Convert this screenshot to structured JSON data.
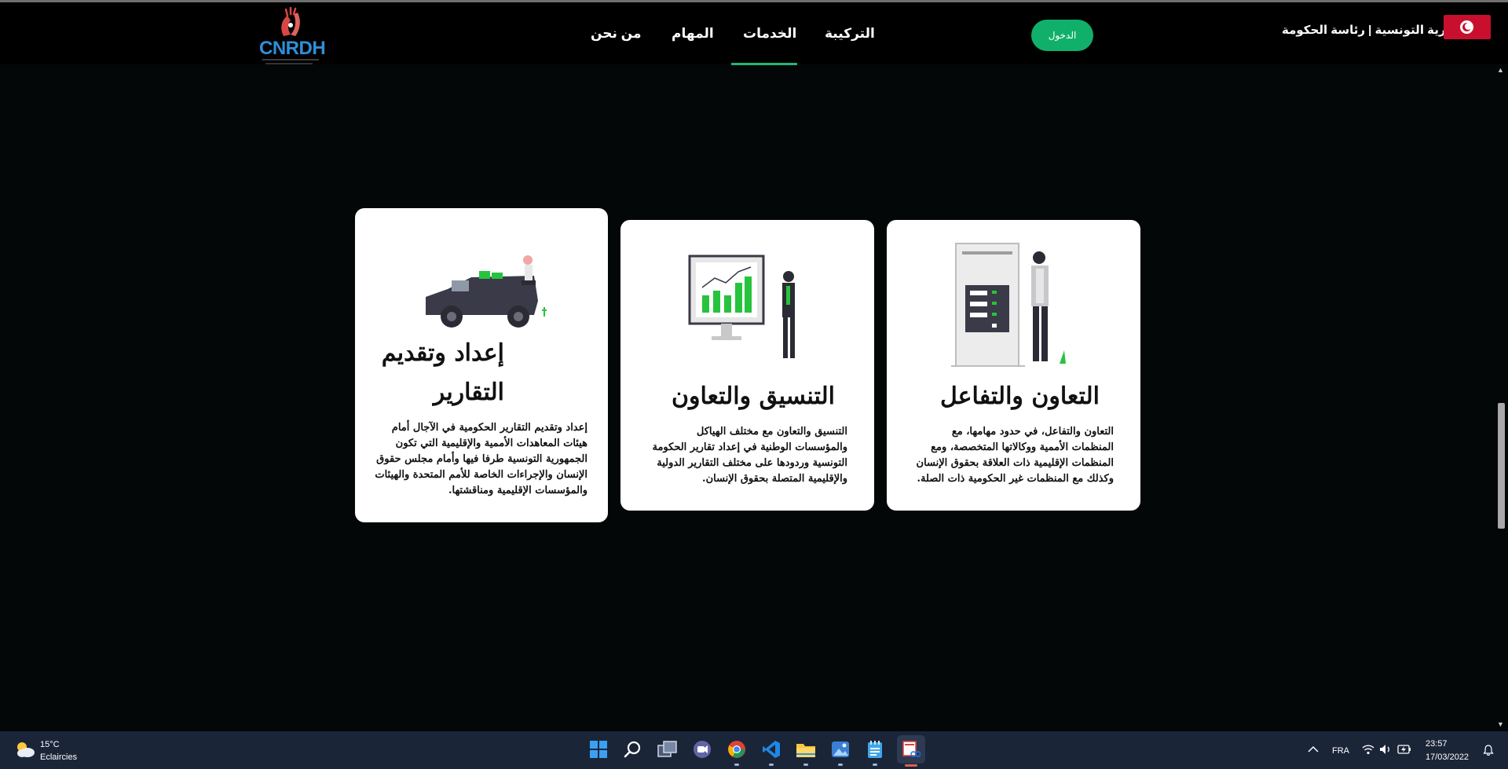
{
  "colors": {
    "accent": "#10b06a",
    "nav_background": "#000000",
    "page_background": "#030708",
    "card_background": "#ffffff",
    "logo_blue": "#2f8fd8",
    "flag_red": "#c8102e"
  },
  "header": {
    "logo_text": "CNRDH",
    "nav": [
      "التركيبة",
      "الخدمات",
      "المهام",
      "من نحن"
    ],
    "active_nav": "الخدمات",
    "login_label": "الدخول",
    "gov_title": "الجمهورية التونسية | رئاسة الحكومة"
  },
  "cards": [
    {
      "title": "التعاون والتفاعل",
      "body": "التعاون والتفاعل، في حدود مهامها، مع المنظمات الأممية ووكالاتها المتخصصة، ومع المنظمات الإقليمية ذات العلاقة بحقوق الإنسان وكذلك مع المنظمات غير الحكومية ذات الصلة.",
      "illustration": "kiosk-person-illustration"
    },
    {
      "title": "التنسيق والتعاون",
      "body": "التنسيق والتعاون مع مختلف الهياكل والمؤسسات الوطنية في إعداد تقارير الحكومة التونسية وردودها على مختلف التقارير الدولية والإقليمية المتصلة بحقوق الإنسان.",
      "illustration": "chart-monitor-illustration"
    },
    {
      "title": "إعداد وتقديم التقارير",
      "body": "إعداد وتقديم التقارير الحكومية في الآجال أمام هيئات المعاهدات الأممية والإقليمية التي تكون الجمهورية التونسية طرفا فيها وأمام مجلس حقوق الإنسان والإجراءات الخاصة للأمم المتحدة والهيئات والمؤسسات الإقليمية ومناقشتها.",
      "illustration": "truck-person-illustration"
    }
  ],
  "taskbar": {
    "weather_temp": "15°C",
    "weather_desc": "Eclaircies",
    "language": "FRA",
    "time": "23:57",
    "date": "17/03/2022",
    "apps": [
      "start-icon",
      "search-icon",
      "task-view-icon",
      "teams-chat-icon",
      "chrome-icon",
      "vscode-icon",
      "file-explorer-icon",
      "photos-icon",
      "notepad-icon",
      "snipping-tool-icon"
    ]
  }
}
